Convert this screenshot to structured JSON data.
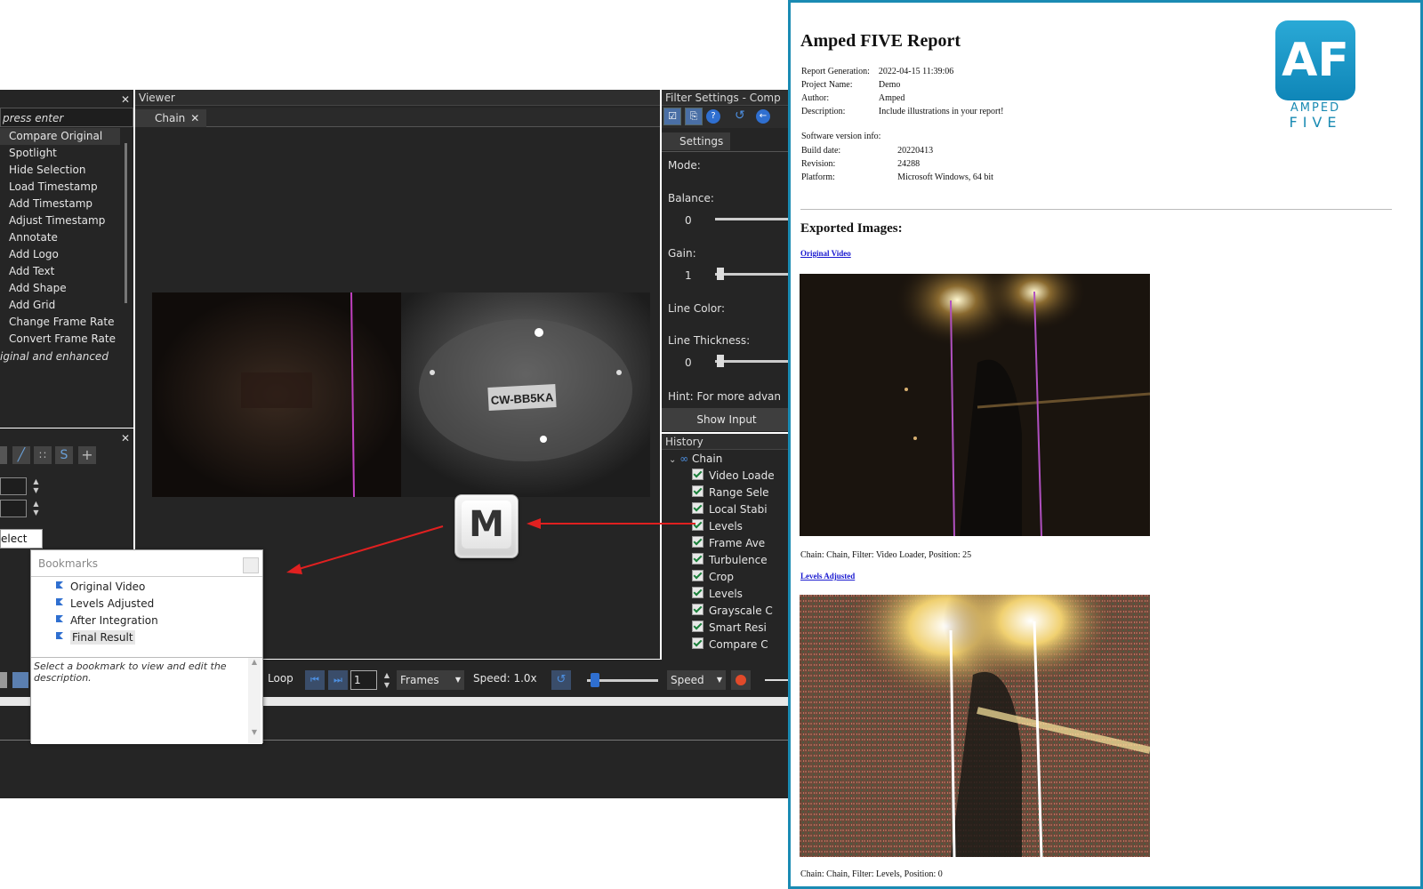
{
  "left_panel": {
    "search_placeholder": "press enter",
    "filters": [
      "Compare Original",
      "Spotlight",
      "Hide Selection",
      "Load Timestamp",
      "Add Timestamp",
      "Adjust Timestamp",
      "Annotate",
      "Add Logo",
      "Add Text",
      "Add Shape",
      "Add Grid",
      "Change Frame Rate",
      "Convert Frame Rate"
    ],
    "description": "iginal and enhanced",
    "select_label": "elect",
    "close": "✕"
  },
  "viewer": {
    "title": "Viewer",
    "tab": "Chain",
    "plate_text": "CW-BB5KA"
  },
  "filter_settings": {
    "title": "Filter Settings - Comp",
    "tab": "Settings",
    "mode_label": "Mode:",
    "balance_label": "Balance:",
    "balance_value": "0",
    "gain_label": "Gain:",
    "gain_value": "1",
    "line_color_label": "Line Color:",
    "line_thickness_label": "Line Thickness:",
    "line_thickness_value": "0",
    "hint": "Hint: For more advan",
    "show_input": "Show Input"
  },
  "history": {
    "title": "History",
    "root": "Chain",
    "items": [
      "Video Loade",
      "Range Sele",
      "Local Stabi",
      "Levels",
      "Frame Ave",
      "Turbulence",
      "Crop",
      "Levels",
      "Grayscale C",
      "Smart Resi",
      "Compare C"
    ]
  },
  "bookmarks": {
    "title": "Bookmarks",
    "items": [
      "Original Video",
      "Levels Adjusted",
      "After Integration",
      "Final Result"
    ],
    "selected": 3,
    "description": "Select a bookmark to view and edit the description."
  },
  "keycap": {
    "label": "M"
  },
  "playback": {
    "loop": "Loop",
    "frame": "1",
    "mode": "Frames",
    "speed": "Speed:  1.0x",
    "speed_select": "Speed"
  },
  "report": {
    "title": "Amped FIVE Report",
    "meta": [
      {
        "k": "Report Generation:",
        "v": "2022-04-15 11:39:06"
      },
      {
        "k": "Project Name:",
        "v": "Demo"
      },
      {
        "k": "Author:",
        "v": "Amped"
      },
      {
        "k": "Description:",
        "v": "Include illustrations in your report!"
      }
    ],
    "software_heading": "Software version info:",
    "software": [
      {
        "k": "Build date:",
        "v": "20220413"
      },
      {
        "k": "Revision:",
        "v": "24288"
      },
      {
        "k": "Platform:",
        "v": "Microsoft Windows, 64 bit"
      }
    ],
    "logo_top": "AF",
    "logo_line1": "AMPED",
    "logo_line2": "FIVE",
    "exported_heading": "Exported Images:",
    "images": [
      {
        "link": "Original Video",
        "caption": "Chain: Chain, Filter: Video Loader, Position: 25"
      },
      {
        "link": "Levels Adjusted",
        "caption": "Chain: Chain, Filter: Levels, Position: 0"
      }
    ]
  },
  "colors": {
    "accent": "#1a8bb3",
    "arrow": "#e02020",
    "dark": "#252525"
  }
}
